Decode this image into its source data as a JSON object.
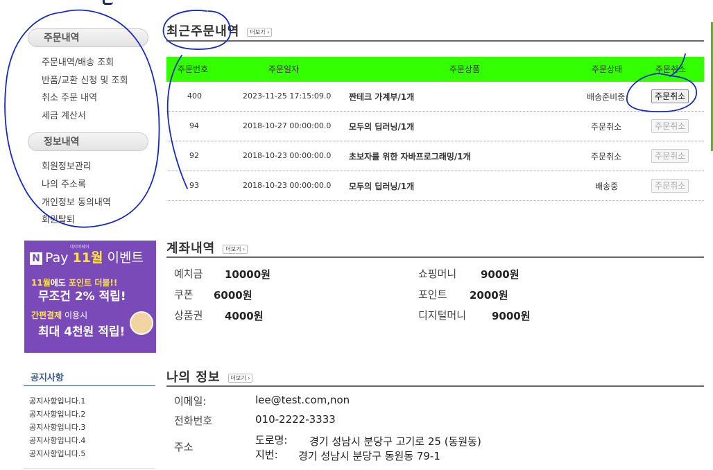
{
  "sidebar": {
    "order_section": "주문내역",
    "order_items": [
      "주문내역/배송 조회",
      "반품/교환 신청 및 조회",
      "취소 주문 내역",
      "세금 계산서"
    ],
    "info_section": "정보내역",
    "info_items": [
      "회원정보관리",
      "나의 주소록",
      "개인정보 동의내역",
      "회원탈퇴"
    ]
  },
  "banner": {
    "brand": "Pay",
    "brand_mark": "N",
    "month": "11월",
    "event": "이벤트",
    "tiny": "네이버페이",
    "line1_a": "11월",
    "line1_b": "에도 ",
    "line1_c": "포인트 더블!!",
    "line2": "무조건 2% 적립!",
    "line3_a": "간편결제",
    "line3_b": " 이용시",
    "line4": "최대 4천원 적립!"
  },
  "notice": {
    "title": "공지사항",
    "items": [
      "공지사항입니다.1",
      "공지사항입니다.2",
      "공지사항입니다.3",
      "공지사항입니다.4",
      "공지사항입니다.5"
    ]
  },
  "more_label": "더보기",
  "orders": {
    "title": "최근주문내역",
    "headers": [
      "주문번호",
      "주문일자",
      "주문상품",
      "주문상태",
      "주문취소"
    ],
    "header_color": "#33ff00",
    "rows": [
      {
        "no": "400",
        "date": "2023-11-25 17:15:09.0",
        "product": "짠테크 가계부/1개",
        "status": "배송준비중",
        "cancel": "주문취소",
        "cancel_enabled": true
      },
      {
        "no": "94",
        "date": "2018-10-27 00:00:00.0",
        "product": "모두의 딥러닝/1개",
        "status": "주문취소",
        "cancel": "주문취소",
        "cancel_enabled": false
      },
      {
        "no": "92",
        "date": "2018-10-23 00:00:00.0",
        "product": "초보자를 위한 자바프로그래밍/1개",
        "status": "주문취소",
        "cancel": "주문취소",
        "cancel_enabled": false
      },
      {
        "no": "93",
        "date": "2018-10-23 00:00:00.0",
        "product": "모두의 딥러닝/1개",
        "status": "배송중",
        "cancel": "주문취소",
        "cancel_enabled": false
      }
    ]
  },
  "account": {
    "title": "계좌내역",
    "deposit_label": "예치금",
    "deposit_value": "10000원",
    "coupon_label": "쿠폰",
    "coupon_value": "6000원",
    "giftcard_label": "상품권",
    "giftcard_value": "4000원",
    "shopping_label": "쇼핑머니",
    "shopping_value": "9000원",
    "point_label": "포인트",
    "point_value": "2000원",
    "digital_label": "디지털머니",
    "digital_value": "9000원"
  },
  "myinfo": {
    "title": "나의 정보",
    "email_label": "이메일:",
    "email_value": "lee@test.com,non",
    "phone_label": "전화번호",
    "phone_value": "010-2222-3333",
    "address_label": "주소",
    "road_label": "도로명:",
    "road_value": "경기 성남시 분당구 고기로 25 (동원동)",
    "lot_label": "지번:",
    "lot_value": "경기 성남시 분당구 동원동 79-1"
  }
}
